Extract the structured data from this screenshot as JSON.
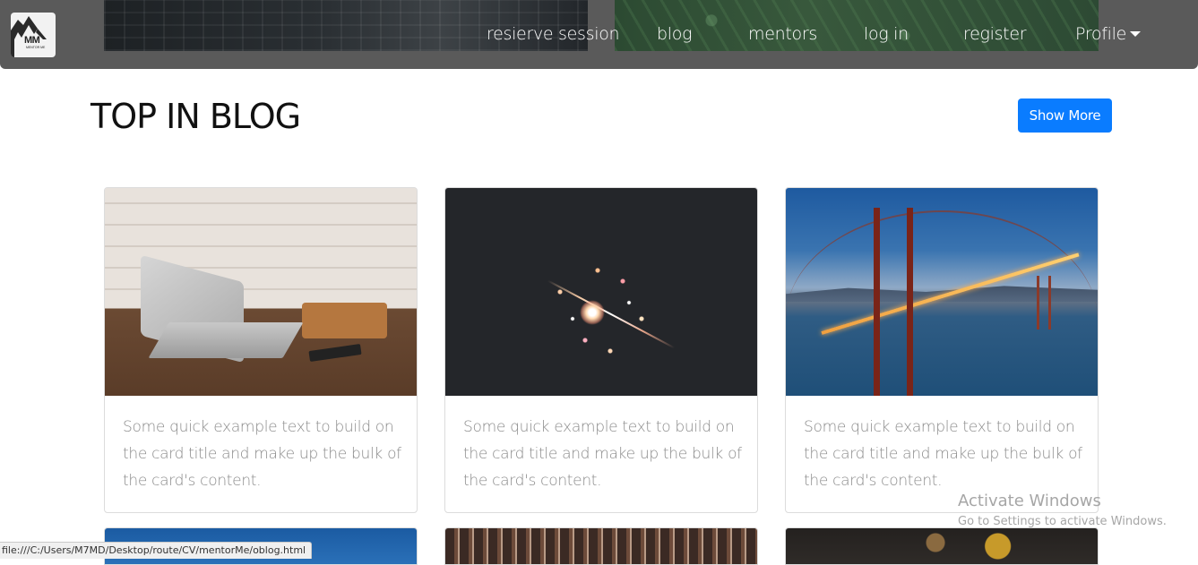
{
  "navbar": {
    "logo_text": "MM",
    "logo_subtext": "MENTOR ME",
    "links": [
      "resierve session",
      "blog",
      "mentors",
      "log in",
      "register",
      "Profile"
    ]
  },
  "header": {
    "title": "TOP IN BLOG",
    "show_more_label": "Show More"
  },
  "cards": [
    {
      "image": "laptop-on-wooden-table",
      "text": "Some quick example text to build on the card title and make up the bulk of the card's content."
    },
    {
      "image": "sparkler-on-dark-background",
      "text": "Some quick example text to build on the card title and make up the bulk of the card's content."
    },
    {
      "image": "golden-gate-bridge-at-dusk",
      "text": "Some quick example text to build on the card title and make up the bulk of the card's content."
    }
  ],
  "second_row_images": [
    "blue-sky",
    "interior-railings",
    "food-bowls-top-view"
  ],
  "status_bar": {
    "url": "file:///C:/Users/M7MD/Desktop/route/CV/mentorMe/oblog.html"
  },
  "watermark": {
    "title": "Activate Windows",
    "subtitle": "Go to Settings to activate Windows."
  },
  "colors": {
    "navbar": "#5a5a5a",
    "primary_button": "#0a7cff",
    "card_text": "#8a8a8a",
    "title": "#111111"
  }
}
